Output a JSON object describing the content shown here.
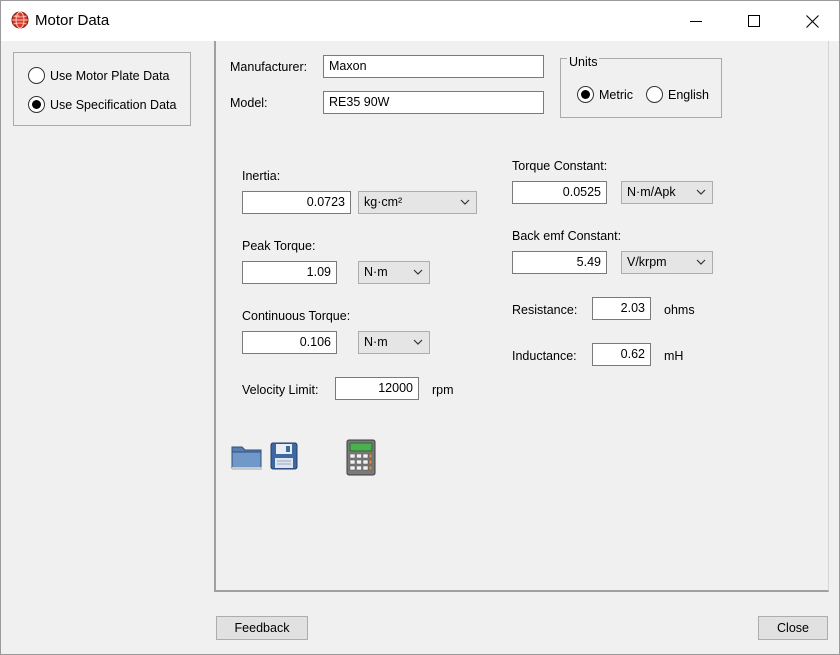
{
  "window": {
    "title": "Motor Data",
    "icon": "red-globe-app-icon"
  },
  "mode": {
    "options": [
      {
        "label": "Use Motor Plate Data",
        "selected": false
      },
      {
        "label": "Use Specification Data",
        "selected": true
      }
    ]
  },
  "info": {
    "manufacturer_label": "Manufacturer:",
    "manufacturer_value": "Maxon",
    "model_label": "Model:",
    "model_value": "RE35 90W"
  },
  "units": {
    "legend": "Units",
    "metric_label": "Metric",
    "english_label": "English",
    "selected": "Metric"
  },
  "params": {
    "inertia": {
      "label": "Inertia:",
      "value": "0.0723",
      "unit": "kg·cm²"
    },
    "peak_torque": {
      "label": "Peak Torque:",
      "value": "1.09",
      "unit": "N·m"
    },
    "continuous_torque": {
      "label": "Continuous Torque:",
      "value": "0.106",
      "unit": "N·m"
    },
    "velocity_limit": {
      "label": "Velocity Limit:",
      "value": "12000",
      "unit": "rpm"
    },
    "torque_constant": {
      "label": "Torque Constant:",
      "value": "0.0525",
      "unit": "N·m/Apk"
    },
    "back_emf": {
      "label": "Back emf Constant:",
      "value": "5.49",
      "unit": "V/krpm"
    },
    "resistance": {
      "label": "Resistance:",
      "value": "2.03",
      "unit": "ohms"
    },
    "inductance": {
      "label": "Inductance:",
      "value": "0.62",
      "unit": "mH"
    }
  },
  "toolbar": {
    "icons": [
      "open-folder-icon",
      "save-disk-icon",
      "calculator-icon"
    ]
  },
  "footer": {
    "feedback_label": "Feedback",
    "close_label": "Close"
  }
}
